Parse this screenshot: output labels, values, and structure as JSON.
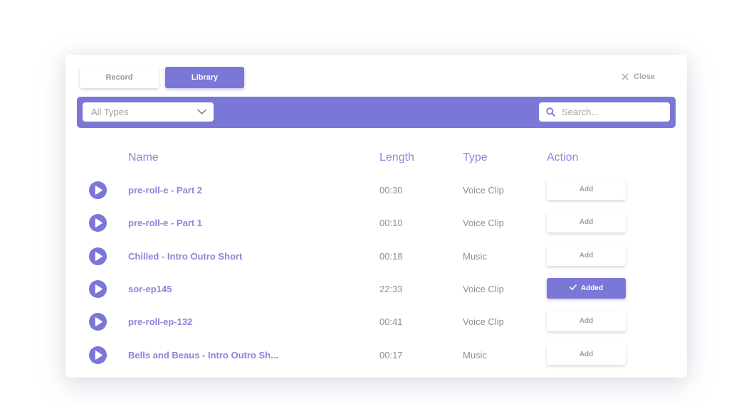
{
  "tabs": [
    {
      "label": "Record",
      "active": false
    },
    {
      "label": "Library",
      "active": true
    }
  ],
  "close_label": "Close",
  "filter": {
    "type_select": {
      "value": "All Types"
    },
    "search": {
      "placeholder": "Search...",
      "value": ""
    }
  },
  "table": {
    "columns": {
      "name": "Name",
      "length": "Length",
      "type": "Type",
      "action": "Action"
    },
    "rows": [
      {
        "name": "pre-roll-e - Part 2",
        "length": "00:30",
        "type": "Voice Clip",
        "action": "Add",
        "added": false
      },
      {
        "name": "pre-roll-e - Part 1",
        "length": "00:10",
        "type": "Voice Clip",
        "action": "Add",
        "added": false
      },
      {
        "name": "Chilled - Intro Outro Short",
        "length": "00:18",
        "type": "Music",
        "action": "Add",
        "added": false
      },
      {
        "name": "sor-ep145",
        "length": "22:33",
        "type": "Voice Clip",
        "action": "Added",
        "added": true
      },
      {
        "name": "pre-roll-ep-132",
        "length": "00:41",
        "type": "Voice Clip",
        "action": "Add",
        "added": false
      },
      {
        "name": "Bells and Beaus - Intro Outro Sh...",
        "length": "00:17",
        "type": "Music",
        "action": "Add",
        "added": false
      }
    ]
  },
  "colors": {
    "accent": "#7b77d6",
    "name_text": "#8a85dc",
    "muted_text": "#8f8f8f"
  }
}
